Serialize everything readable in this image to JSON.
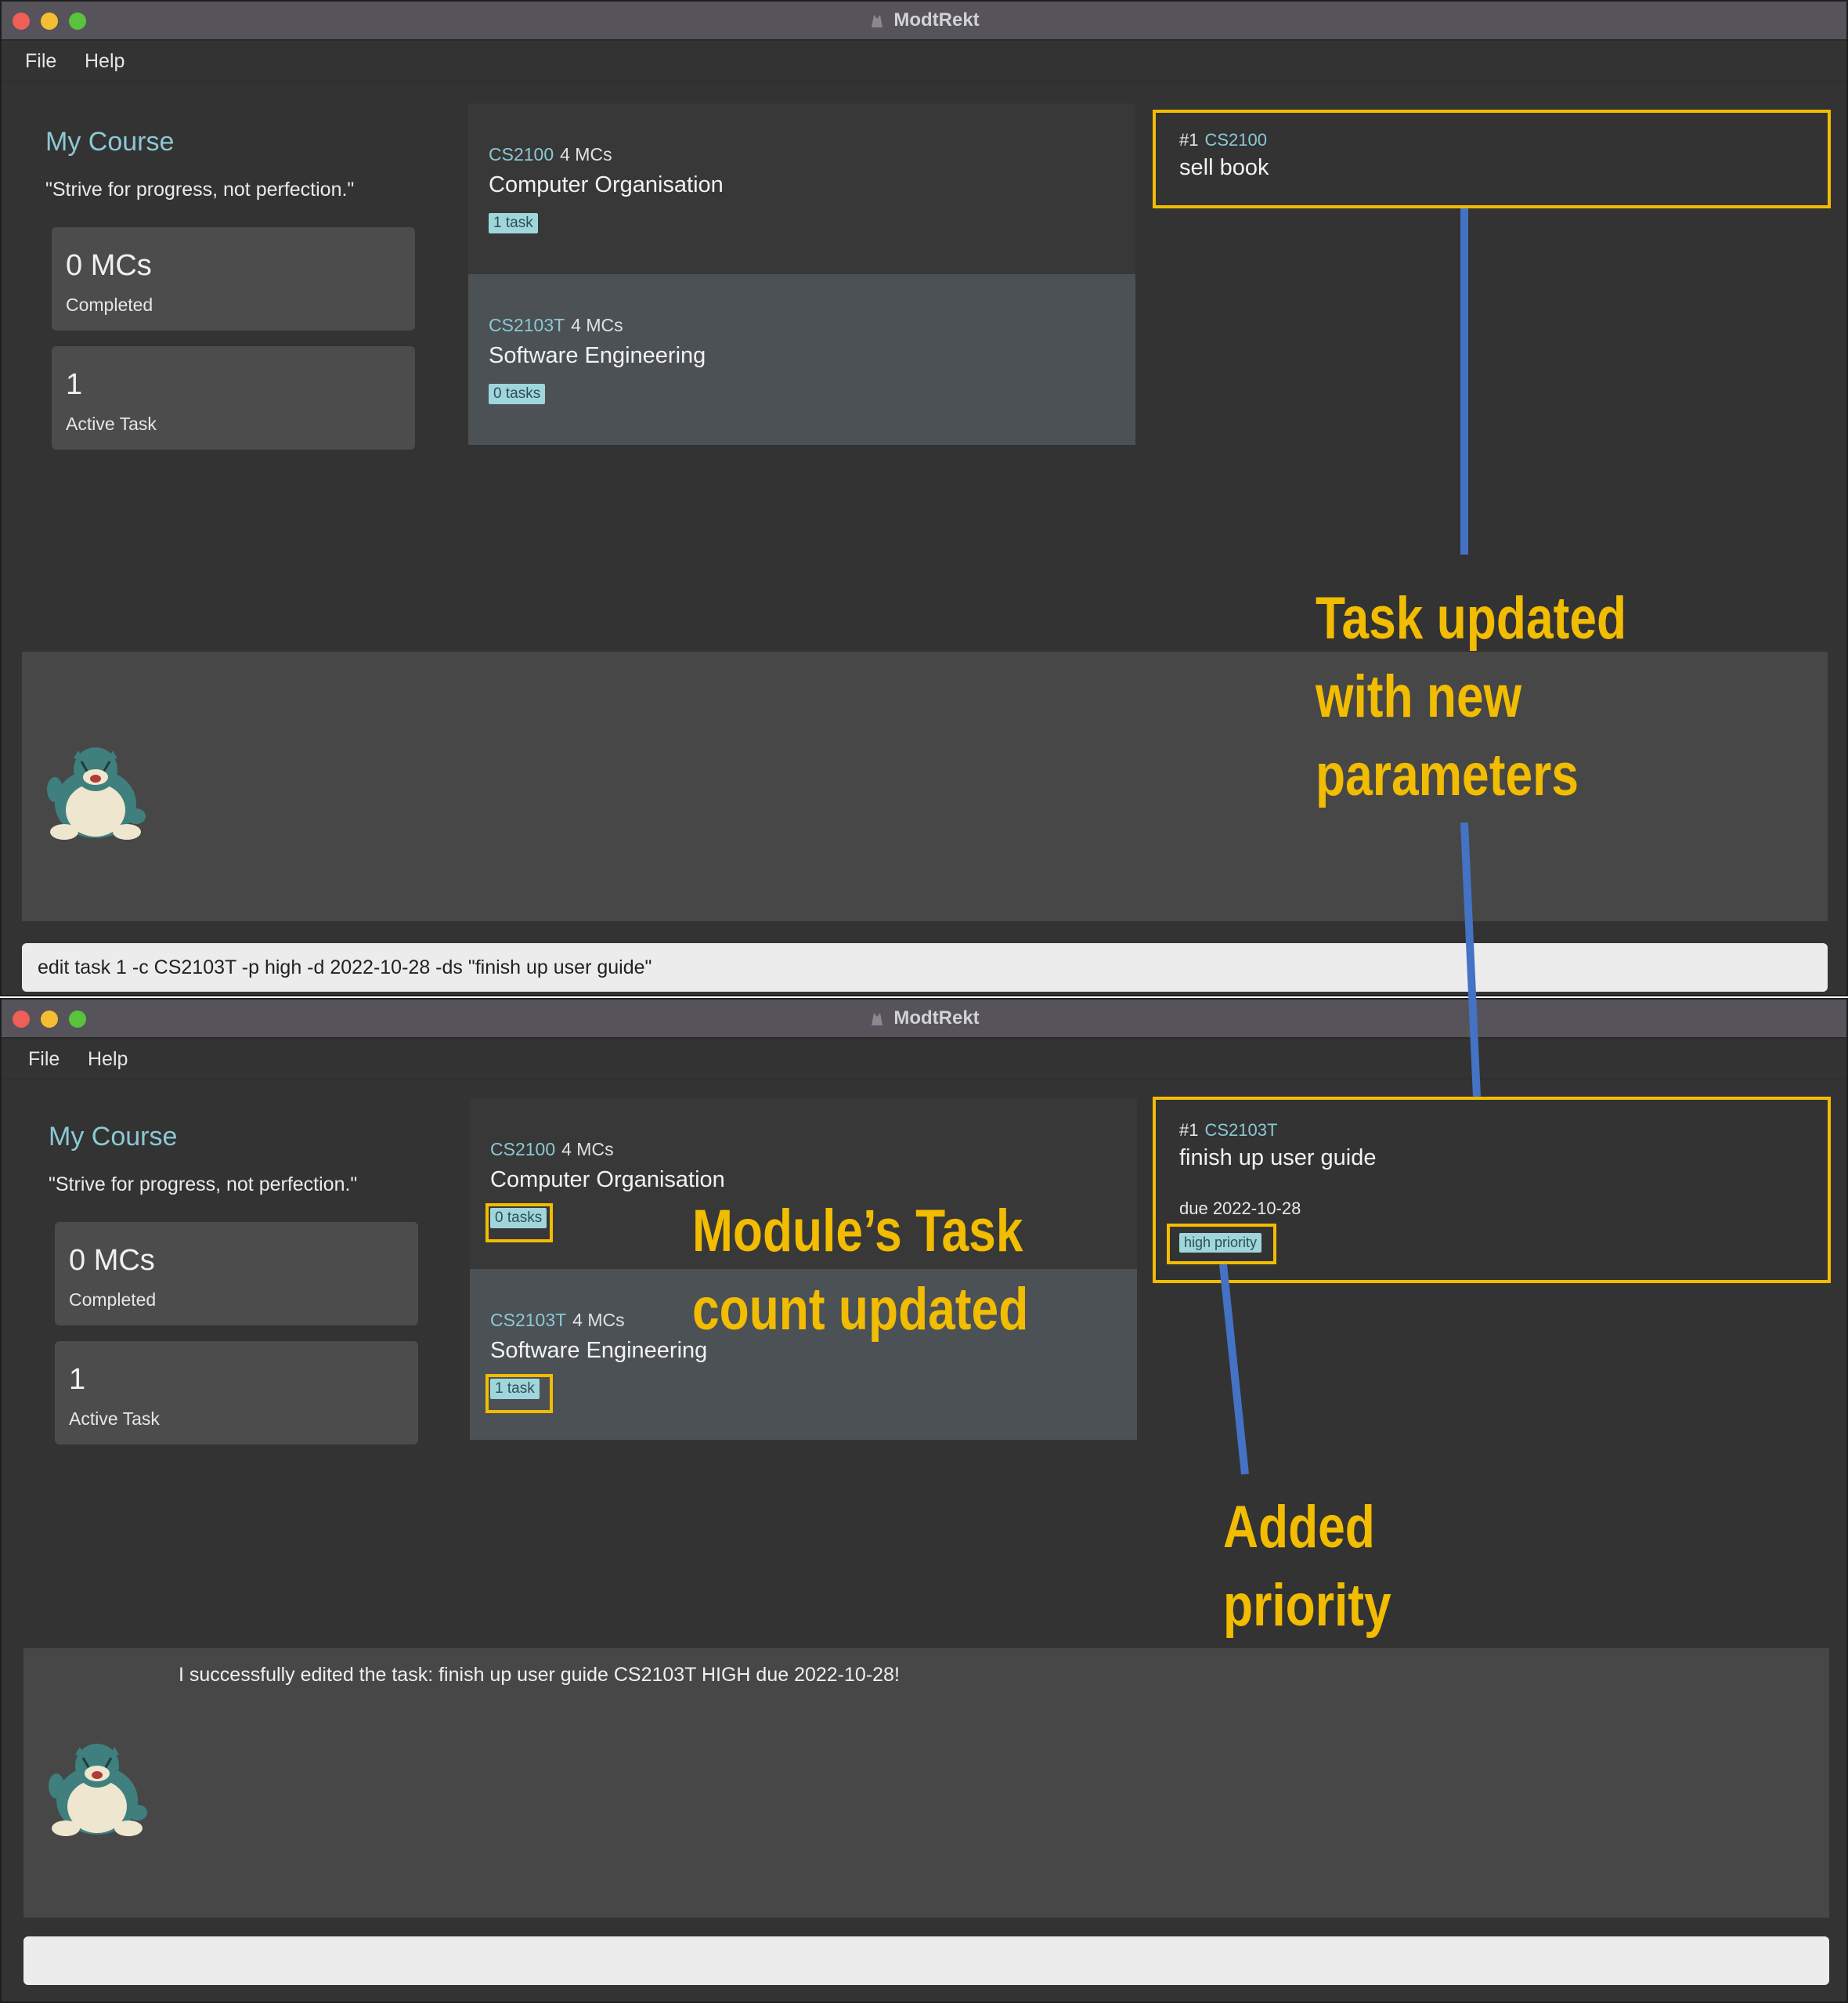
{
  "before": {
    "app_title": "ModtRekt",
    "menu": [
      "File",
      "Help"
    ],
    "course": {
      "title": "My Course",
      "quote": "\"Strive for progress, not perfection.\""
    },
    "stats": [
      {
        "value": "0 MCs",
        "label": "Completed"
      },
      {
        "value": "1",
        "label": "Active Task"
      }
    ],
    "modules": [
      {
        "code": "CS2100",
        "mcs": "4 MCs",
        "name": "Computer Organisation",
        "tasks": "1 task"
      },
      {
        "code": "CS2103T",
        "mcs": "4 MCs",
        "name": "Software Engineering",
        "tasks": "0 tasks"
      }
    ],
    "task": {
      "index": "#1",
      "code": "CS2100",
      "description": "sell book"
    },
    "result_text": "",
    "command_input": "edit task 1 -c CS2103T -p high -d 2022-10-28 -ds \"finish up user guide\""
  },
  "after": {
    "app_title": "ModtRekt",
    "menu": [
      "File",
      "Help"
    ],
    "course": {
      "title": "My Course",
      "quote": "\"Strive for progress, not perfection.\""
    },
    "stats": [
      {
        "value": "0 MCs",
        "label": "Completed"
      },
      {
        "value": "1",
        "label": "Active Task"
      }
    ],
    "modules": [
      {
        "code": "CS2100",
        "mcs": "4 MCs",
        "name": "Computer Organisation",
        "tasks": "0 tasks"
      },
      {
        "code": "CS2103T",
        "mcs": "4 MCs",
        "name": "Software Engineering",
        "tasks": "1 task"
      }
    ],
    "task": {
      "index": "#1",
      "code": "CS2103T",
      "description": "finish up user guide",
      "due": "due 2022-10-28",
      "priority": "high priority"
    },
    "result_text": "I successfully edited the task: finish up user guide CS2103T HIGH due 2022-10-28!",
    "command_input": ""
  },
  "annotations": {
    "task_updated": [
      "Task updated",
      "with new",
      "parameters"
    ],
    "module_count": [
      "Module’s Task",
      "count updated"
    ],
    "added_priority": [
      "Added",
      "priority"
    ]
  },
  "colors": {
    "annotation": "#f2bc00",
    "connector": "#4472c4",
    "accent": "#8cc8d4",
    "background": "#333333"
  },
  "icons": {
    "mascot": "snorlax-mascot-icon",
    "app": "app-logo-icon"
  }
}
